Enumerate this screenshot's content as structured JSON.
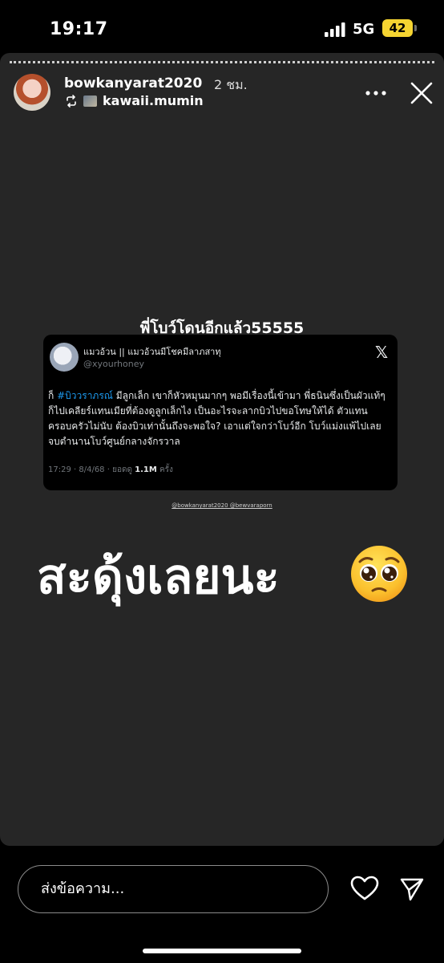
{
  "status_bar": {
    "time": "19:17",
    "network": "5G",
    "battery": "42",
    "battery_color": "#f5d431"
  },
  "story": {
    "username": "bowkanyarat2020",
    "time_ago": "2 ชม.",
    "reposted_from": "kawaii.mumin",
    "overlay_text_top": "พี่โบว์โดนอีกแล้ว55555",
    "tweet": {
      "author_name": "แมวอ้วน || แมวอ้วนมีโชคมีลาภสาทุ",
      "handle": "@xyourhoney",
      "body_prefix": "ก็ ",
      "hashtag": "#บิววราภรณ์",
      "body_rest": " มีลูกเล็ก เขาก็หัวหมุนมากๆ พอมีเรื่องนี้เข้ามา พี่ธนินซึ่งเป็นผัวแท้ๆ ก็ไปเคลียร์แทนเมียที่ต้องดูลูกเล็กไง เป็นอะไรจะลากบิวไปขอโทษให้ได้ ตัวแทนครอบครัวไม่นับ ต้องบิวเท่านั้นถึงจะพอใจ? เอาแต่ใจกว่าโบว์อีก โบว์แม่งแพ้ไปเลย จบตำนานโบว์ศูนย์กลางจักรวาล",
      "time_date": "17:29 · 8/4/68 · ยอดดู ",
      "views": "1.1M",
      "views_suffix": " ครั้ง",
      "hashtag_color": "#1d9bf0"
    },
    "credit": "@bowkanyarat2020 @bewvaraporn",
    "caption": "สะดุ้งเลยนะ",
    "emoji": "pleading-face-emoji"
  },
  "reply": {
    "placeholder": "ส่งข้อความ..."
  },
  "icons": {
    "more": "more-horizontal-icon",
    "close": "close-icon",
    "repost": "repost-icon",
    "heart": "heart-icon",
    "send": "send-icon",
    "x_logo": "x-logo-icon"
  }
}
